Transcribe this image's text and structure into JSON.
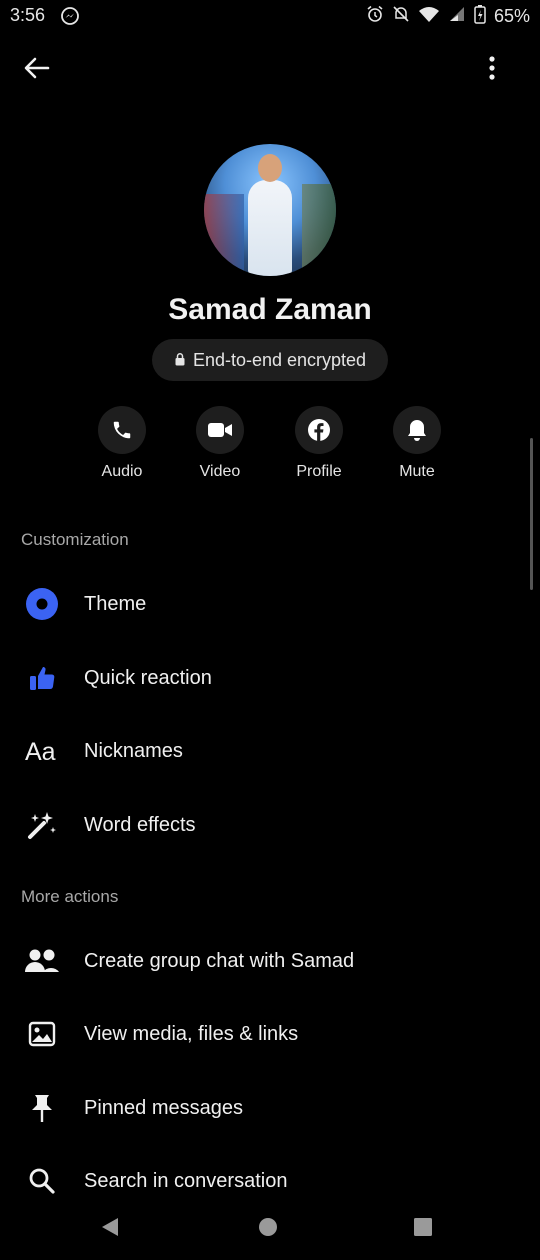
{
  "status_bar": {
    "time": "3:56",
    "battery_percent": "65%",
    "left_icon": "messenger-notification-icon",
    "right_icons": [
      "alarm-icon",
      "mute-icon",
      "wifi-icon",
      "signal-icon",
      "battery-icon"
    ]
  },
  "header": {
    "back_icon": "back-arrow-icon",
    "more_icon": "more-vertical-icon"
  },
  "profile": {
    "name": "Samad Zaman",
    "encryption_label": "End-to-end encrypted"
  },
  "actions": [
    {
      "label": "Audio",
      "icon": "phone-icon"
    },
    {
      "label": "Video",
      "icon": "video-camera-icon"
    },
    {
      "label": "Profile",
      "icon": "facebook-icon"
    },
    {
      "label": "Mute",
      "icon": "bell-icon"
    }
  ],
  "customization": {
    "header": "Customization",
    "items": [
      {
        "label": "Theme",
        "icon": "theme-circle-icon"
      },
      {
        "label": "Quick reaction",
        "icon": "thumbs-up-icon"
      },
      {
        "label": "Nicknames",
        "icon": "nickname-aa-icon"
      },
      {
        "label": "Word effects",
        "icon": "magic-wand-icon"
      }
    ]
  },
  "more_actions": {
    "header": "More actions",
    "items": [
      {
        "label": "Create group chat with Samad",
        "icon": "group-icon"
      },
      {
        "label": "View media, files & links",
        "icon": "image-icon"
      },
      {
        "label": "Pinned messages",
        "icon": "pin-icon"
      },
      {
        "label": "Search in conversation",
        "icon": "search-icon"
      }
    ]
  },
  "colors": {
    "accent": "#3b63f3",
    "background": "#000000",
    "surface": "#1e1e1e"
  },
  "nav_bar": {
    "icons": [
      "nav-back-icon",
      "nav-home-icon",
      "nav-recents-icon"
    ]
  }
}
